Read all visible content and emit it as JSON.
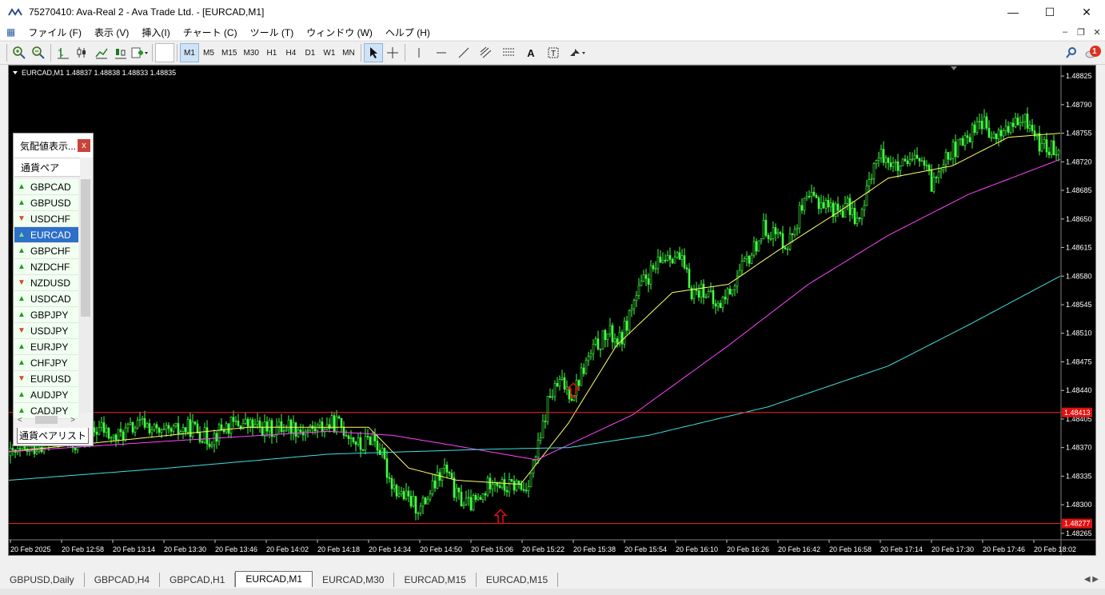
{
  "window": {
    "title": "75270410: Ava-Real 2 - Ava Trade Ltd. - [EURCAD,M1]",
    "min_icon": "minimize-icon",
    "max_icon": "maximize-icon",
    "close_icon": "close-icon"
  },
  "menu": [
    "ファイル (F)",
    "表示 (V)",
    "挿入(I)",
    "チャート (C)",
    "ツール (T)",
    "ウィンドウ (W)",
    "ヘルプ (H)"
  ],
  "timeframes": [
    "M1",
    "M5",
    "M15",
    "M30",
    "H1",
    "H4",
    "D1",
    "W1",
    "MN"
  ],
  "active_timeframe": "M1",
  "notification_count": "1",
  "market_watch": {
    "title": "気配値表示...",
    "close_label": "x",
    "column_header": "通貨ペア",
    "tab_label": "通貨ペアリスト",
    "rows": [
      {
        "symbol": "GBPCAD",
        "dir": "up"
      },
      {
        "symbol": "GBPUSD",
        "dir": "up"
      },
      {
        "symbol": "USDCHF",
        "dir": "down"
      },
      {
        "symbol": "EURCAD",
        "dir": "up",
        "selected": true
      },
      {
        "symbol": "GBPCHF",
        "dir": "up"
      },
      {
        "symbol": "NZDCHF",
        "dir": "up"
      },
      {
        "symbol": "NZDUSD",
        "dir": "down"
      },
      {
        "symbol": "USDCAD",
        "dir": "up"
      },
      {
        "symbol": "GBPJPY",
        "dir": "up"
      },
      {
        "symbol": "USDJPY",
        "dir": "down"
      },
      {
        "symbol": "EURJPY",
        "dir": "up"
      },
      {
        "symbol": "CHFJPY",
        "dir": "up"
      },
      {
        "symbol": "EURUSD",
        "dir": "down"
      },
      {
        "symbol": "AUDJPY",
        "dir": "up"
      },
      {
        "symbol": "CADJPY",
        "dir": "up"
      }
    ]
  },
  "tabs": [
    "GBPUSD,Daily",
    "GBPCAD,H4",
    "GBPCAD,H1",
    "EURCAD,M1",
    "EURCAD,M30",
    "EURCAD,M15",
    "EURCAD,M15"
  ],
  "active_tab": "EURCAD,M1",
  "chart_data": {
    "type": "candlestick",
    "symbol_header": "EURCAD,M1  1.48837 1.48838 1.48833 1.48835",
    "ylim": [
      1.4826,
      1.4883
    ],
    "y_ticks": [
      "1.48825",
      "1.48790",
      "1.48755",
      "1.48720",
      "1.48685",
      "1.48650",
      "1.48615",
      "1.48580",
      "1.48545",
      "1.48510",
      "1.48475",
      "1.48440",
      "1.48405",
      "1.48370",
      "1.48335",
      "1.48300",
      "1.48265"
    ],
    "x_ticks": [
      "20 Feb 2025",
      "20 Feb 12:58",
      "20 Feb 13:14",
      "20 Feb 13:30",
      "20 Feb 13:46",
      "20 Feb 14:02",
      "20 Feb 14:18",
      "20 Feb 14:34",
      "20 Feb 14:50",
      "20 Feb 15:06",
      "20 Feb 15:22",
      "20 Feb 15:38",
      "20 Feb 15:54",
      "20 Feb 16:10",
      "20 Feb 16:26",
      "20 Feb 16:42",
      "20 Feb 16:58",
      "20 Feb 17:14",
      "20 Feb 17:30",
      "20 Feb 17:46",
      "20 Feb 18:02"
    ],
    "horizontal_lines": [
      {
        "value": 1.48413,
        "label": "1.48413",
        "color": "#ff2020"
      },
      {
        "value": 1.48277,
        "label": "1.48277",
        "color": "#ff2020"
      }
    ],
    "price_path": [
      [
        0,
        1.4836
      ],
      [
        20,
        1.48365
      ],
      [
        40,
        1.48375
      ],
      [
        60,
        1.48378
      ],
      [
        80,
        1.48372
      ],
      [
        100,
        1.48385
      ],
      [
        115,
        1.48395
      ],
      [
        130,
        1.4838
      ],
      [
        150,
        1.48392
      ],
      [
        170,
        1.484
      ],
      [
        190,
        1.48385
      ],
      [
        210,
        1.4839
      ],
      [
        230,
        1.48395
      ],
      [
        250,
        1.4838
      ],
      [
        270,
        1.48395
      ],
      [
        290,
        1.484
      ],
      [
        310,
        1.48395
      ],
      [
        330,
        1.48392
      ],
      [
        350,
        1.48398
      ],
      [
        370,
        1.4839
      ],
      [
        390,
        1.48395
      ],
      [
        410,
        1.484
      ],
      [
        425,
        1.48388
      ],
      [
        440,
        1.4837
      ],
      [
        455,
        1.48385
      ],
      [
        465,
        1.48365
      ],
      [
        475,
        1.48335
      ],
      [
        485,
        1.48318
      ],
      [
        500,
        1.48305
      ],
      [
        515,
        1.48295
      ],
      [
        530,
        1.4832
      ],
      [
        545,
        1.48345
      ],
      [
        560,
        1.4831
      ],
      [
        575,
        1.483
      ],
      [
        590,
        1.48305
      ],
      [
        605,
        1.48335
      ],
      [
        620,
        1.4832
      ],
      [
        635,
        1.48325
      ],
      [
        645,
        1.48318
      ],
      [
        655,
        1.48345
      ],
      [
        665,
        1.4838
      ],
      [
        675,
        1.4843
      ],
      [
        690,
        1.4845
      ],
      [
        705,
        1.48435
      ],
      [
        720,
        1.4847
      ],
      [
        735,
        1.48495
      ],
      [
        750,
        1.4851
      ],
      [
        765,
        1.485
      ],
      [
        780,
        1.48545
      ],
      [
        795,
        1.48575
      ],
      [
        810,
        1.4859
      ],
      [
        825,
        1.4861
      ],
      [
        840,
        1.486
      ],
      [
        855,
        1.4856
      ],
      [
        870,
        1.48565
      ],
      [
        885,
        1.4854
      ],
      [
        900,
        1.4856
      ],
      [
        915,
        1.48585
      ],
      [
        930,
        1.4861
      ],
      [
        945,
        1.4864
      ],
      [
        960,
        1.4863
      ],
      [
        975,
        1.4862
      ],
      [
        990,
        1.4866
      ],
      [
        1005,
        1.48675
      ],
      [
        1020,
        1.4867
      ],
      [
        1035,
        1.4866
      ],
      [
        1050,
        1.48665
      ],
      [
        1065,
        1.48645
      ],
      [
        1080,
        1.48715
      ],
      [
        1095,
        1.4873
      ],
      [
        1110,
        1.4871
      ],
      [
        1125,
        1.48715
      ],
      [
        1140,
        1.48725
      ],
      [
        1155,
        1.4869
      ],
      [
        1170,
        1.4873
      ],
      [
        1185,
        1.48735
      ],
      [
        1200,
        1.4875
      ],
      [
        1215,
        1.48775
      ],
      [
        1230,
        1.48745
      ],
      [
        1245,
        1.4876
      ],
      [
        1260,
        1.48765
      ],
      [
        1275,
        1.4877
      ],
      [
        1290,
        1.4874
      ],
      [
        1305,
        1.48735
      ],
      [
        1315,
        1.4874
      ]
    ],
    "ma_series": [
      {
        "color": "#ffff66",
        "values": [
          [
            0,
            1.48365
          ],
          [
            150,
            1.4838
          ],
          [
            300,
            1.48395
          ],
          [
            450,
            1.48395
          ],
          [
            500,
            1.48345
          ],
          [
            560,
            1.4833
          ],
          [
            640,
            1.48325
          ],
          [
            700,
            1.484
          ],
          [
            760,
            1.48495
          ],
          [
            830,
            1.4856
          ],
          [
            900,
            1.4857
          ],
          [
            960,
            1.4861
          ],
          [
            1040,
            1.4866
          ],
          [
            1100,
            1.487
          ],
          [
            1180,
            1.48715
          ],
          [
            1250,
            1.4875
          ],
          [
            1315,
            1.48755
          ]
        ]
      },
      {
        "color": "#ff44ff",
        "values": [
          [
            0,
            1.48365
          ],
          [
            200,
            1.48378
          ],
          [
            400,
            1.4839
          ],
          [
            480,
            1.48385
          ],
          [
            560,
            1.48372
          ],
          [
            660,
            1.48355
          ],
          [
            780,
            1.4841
          ],
          [
            900,
            1.48495
          ],
          [
            1000,
            1.4857
          ],
          [
            1100,
            1.4863
          ],
          [
            1200,
            1.4868
          ],
          [
            1315,
            1.48723
          ]
        ]
      },
      {
        "color": "#40e0e0",
        "values": [
          [
            0,
            1.4833
          ],
          [
            200,
            1.48345
          ],
          [
            400,
            1.48362
          ],
          [
            600,
            1.48368
          ],
          [
            700,
            1.4837
          ],
          [
            800,
            1.48385
          ],
          [
            950,
            1.4842
          ],
          [
            1100,
            1.4847
          ],
          [
            1200,
            1.4852
          ],
          [
            1315,
            1.4858
          ]
        ]
      }
    ],
    "arrows": [
      {
        "x": 615,
        "value": 1.48285
      },
      {
        "x": 706,
        "value": 1.4844
      }
    ]
  }
}
